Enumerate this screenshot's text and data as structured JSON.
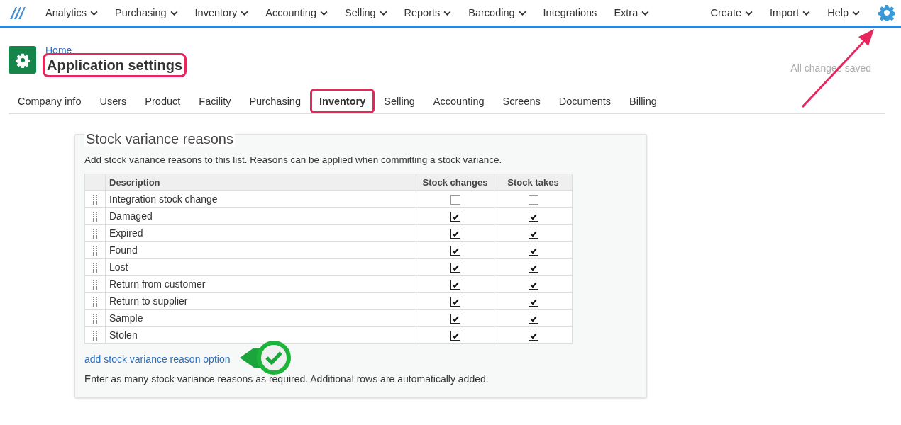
{
  "nav": {
    "items": [
      {
        "label": "Analytics",
        "dropdown": true
      },
      {
        "label": "Purchasing",
        "dropdown": true
      },
      {
        "label": "Inventory",
        "dropdown": true
      },
      {
        "label": "Accounting",
        "dropdown": true
      },
      {
        "label": "Selling",
        "dropdown": true
      },
      {
        "label": "Reports",
        "dropdown": true
      },
      {
        "label": "Barcoding",
        "dropdown": true
      },
      {
        "label": "Integrations",
        "dropdown": false
      },
      {
        "label": "Extra",
        "dropdown": true
      }
    ],
    "right_items": [
      {
        "label": "Create",
        "dropdown": true
      },
      {
        "label": "Import",
        "dropdown": true
      },
      {
        "label": "Help",
        "dropdown": true
      }
    ]
  },
  "header": {
    "breadcrumb": "Home",
    "title": "Application settings",
    "title_highlighted": true,
    "save_status": "All changes saved"
  },
  "tabs": [
    {
      "label": "Company info",
      "selected": false,
      "highlighted": false
    },
    {
      "label": "Users",
      "selected": false,
      "highlighted": false
    },
    {
      "label": "Product",
      "selected": false,
      "highlighted": false
    },
    {
      "label": "Facility",
      "selected": false,
      "highlighted": false
    },
    {
      "label": "Purchasing",
      "selected": false,
      "highlighted": false
    },
    {
      "label": "Inventory",
      "selected": true,
      "highlighted": true
    },
    {
      "label": "Selling",
      "selected": false,
      "highlighted": false
    },
    {
      "label": "Accounting",
      "selected": false,
      "highlighted": false
    },
    {
      "label": "Screens",
      "selected": false,
      "highlighted": false
    },
    {
      "label": "Documents",
      "selected": false,
      "highlighted": false
    },
    {
      "label": "Billing",
      "selected": false,
      "highlighted": false
    }
  ],
  "section": {
    "title": "Stock variance reasons",
    "intro": "Add stock variance reasons to this list. Reasons can be applied when committing a stock variance.",
    "table": {
      "columns": [
        "Description",
        "Stock changes",
        "Stock takes"
      ],
      "rows": [
        {
          "description": "Integration stock change",
          "stock_changes": false,
          "stock_takes": false
        },
        {
          "description": "Damaged",
          "stock_changes": true,
          "stock_takes": true
        },
        {
          "description": "Expired",
          "stock_changes": true,
          "stock_takes": true
        },
        {
          "description": "Found",
          "stock_changes": true,
          "stock_takes": true
        },
        {
          "description": "Lost",
          "stock_changes": true,
          "stock_takes": true
        },
        {
          "description": "Return from customer",
          "stock_changes": true,
          "stock_takes": true
        },
        {
          "description": "Return to supplier",
          "stock_changes": true,
          "stock_takes": true
        },
        {
          "description": "Sample",
          "stock_changes": true,
          "stock_takes": true
        },
        {
          "description": "Stolen",
          "stock_changes": true,
          "stock_takes": true
        }
      ]
    },
    "add_link": "add stock variance reason option",
    "footnote": "Enter as many stock variance reasons as required. Additional rows are automatically added."
  }
}
